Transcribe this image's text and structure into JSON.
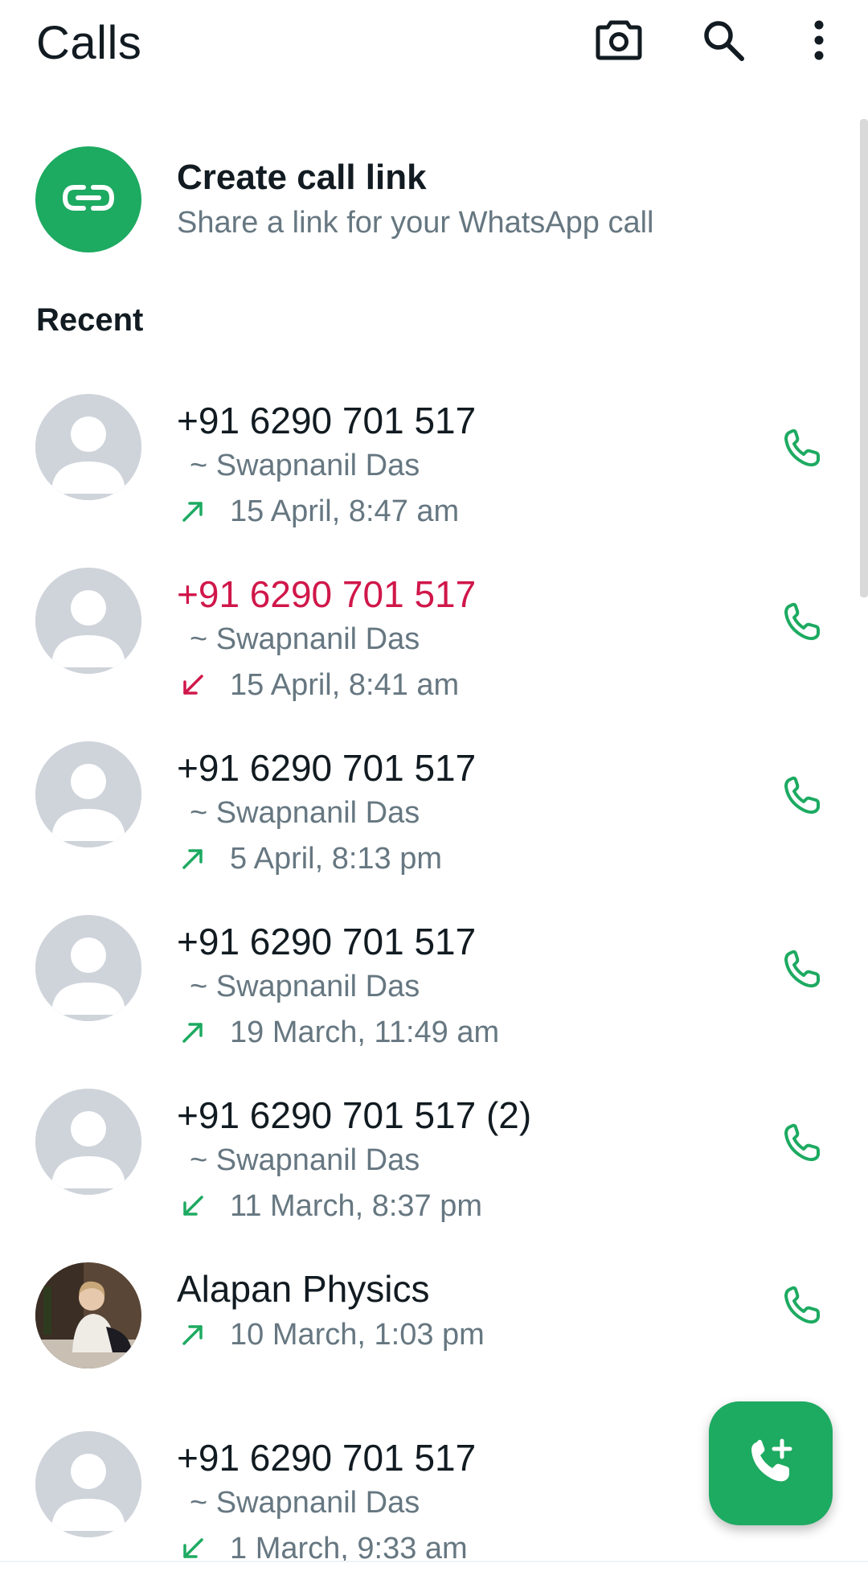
{
  "header": {
    "title": "Calls",
    "icons": [
      "camera-icon",
      "search-icon",
      "more-vert-icon"
    ]
  },
  "create_link": {
    "title": "Create call link",
    "subtitle": "Share a link for your WhatsApp call",
    "icon": "link-icon"
  },
  "section": {
    "recent_label": "Recent"
  },
  "colors": {
    "accent_green": "#1daa61",
    "missed_red": "#d0174a",
    "secondary_text": "#667781",
    "avatar_placeholder": "#cfd4db"
  },
  "calls": [
    {
      "name": "+91 6290 701 517",
      "subtitle": "~ Swapnanil Das",
      "time": "15 April, 8:47 am",
      "direction": "outgoing",
      "missed": false
    },
    {
      "name": "+91 6290 701 517",
      "subtitle": "~ Swapnanil Das",
      "time": "15 April, 8:41 am",
      "direction": "incoming",
      "missed": true
    },
    {
      "name": "+91 6290 701 517",
      "subtitle": "~ Swapnanil Das",
      "time": "5 April, 8:13 pm",
      "direction": "outgoing",
      "missed": false
    },
    {
      "name": "+91 6290 701 517",
      "subtitle": "~ Swapnanil Das",
      "time": "19 March, 11:49 am",
      "direction": "outgoing",
      "missed": false
    },
    {
      "name": "+91 6290 701 517 (2)",
      "subtitle": "~ Swapnanil Das",
      "time": "11 March, 8:37 pm",
      "direction": "incoming",
      "missed": false
    },
    {
      "name": "Alapan Physics",
      "subtitle": "",
      "time": "10 March, 1:03 pm",
      "direction": "outgoing",
      "missed": false
    },
    {
      "name": "+91 6290 701 517",
      "subtitle": "~ Swapnanil Das",
      "time": "1 March, 9:33 am",
      "direction": "incoming",
      "missed": false
    }
  ],
  "fab": {
    "icon": "add-call-icon"
  }
}
